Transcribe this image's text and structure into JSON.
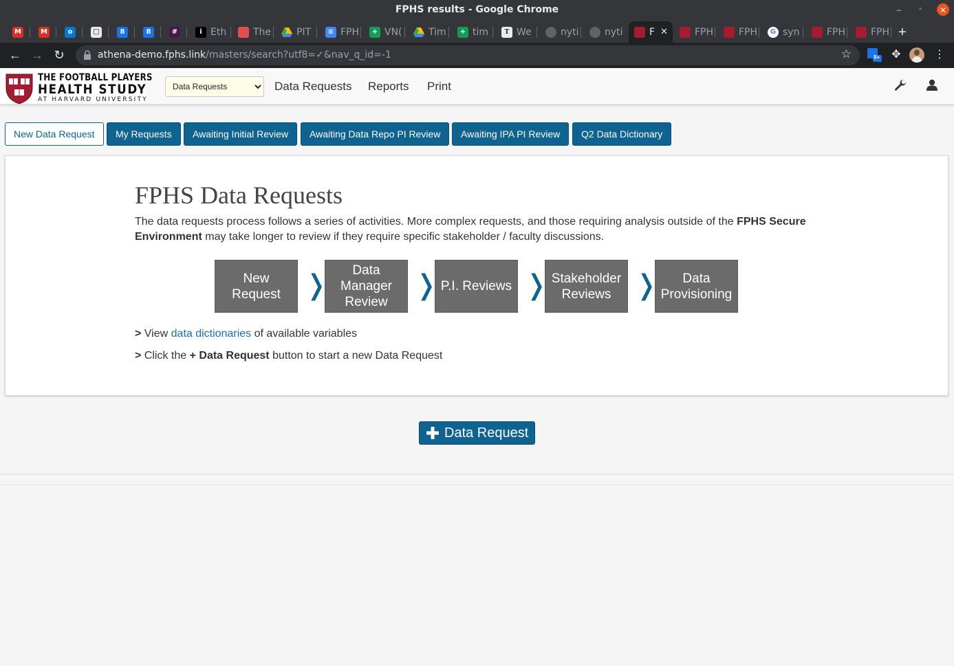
{
  "window": {
    "title": "FPHS results - Google Chrome"
  },
  "tabs": [
    {
      "label": "",
      "icon": "gmail-icon",
      "color": "#d93025"
    },
    {
      "label": "",
      "icon": "gmail-icon",
      "color": "#d93025"
    },
    {
      "label": "",
      "icon": "outlook-icon",
      "color": "#0078d4"
    },
    {
      "label": "",
      "icon": "book-icon",
      "color": "#e8eaed"
    },
    {
      "label": "",
      "icon": "calendar-icon",
      "color": "#1a73e8"
    },
    {
      "label": "",
      "icon": "calendar-icon",
      "color": "#1a73e8"
    },
    {
      "label": "",
      "icon": "slack-icon",
      "color": "#e01e5a"
    },
    {
      "label": "Eth",
      "icon": "info-icon",
      "color": "#000000"
    },
    {
      "label": "The",
      "icon": "ticket-icon",
      "color": "#e05050"
    },
    {
      "label": "PIT",
      "icon": "drive-icon",
      "color": "#34a853"
    },
    {
      "label": "FPH",
      "icon": "docs-icon",
      "color": "#4285f4"
    },
    {
      "label": "VN(",
      "icon": "sheets-icon",
      "color": "#0f9d58"
    },
    {
      "label": "Tim",
      "icon": "drive-icon",
      "color": "#34a853"
    },
    {
      "label": "tim",
      "icon": "sheets-icon",
      "color": "#0f9d58"
    },
    {
      "label": "We",
      "icon": "nytimes-icon",
      "color": "#e8eaed"
    },
    {
      "label": "nyti",
      "icon": "github-icon",
      "color": "#e8eaed"
    },
    {
      "label": "nyti",
      "icon": "github-icon",
      "color": "#e8eaed"
    },
    {
      "label": "F",
      "icon": "harvard-shield-icon",
      "color": "#a51c30"
    },
    {
      "label": "FPH",
      "icon": "harvard-shield-icon",
      "color": "#a51c30"
    },
    {
      "label": "FPH",
      "icon": "harvard-shield-icon",
      "color": "#a51c30"
    },
    {
      "label": "syn",
      "icon": "google-icon",
      "color": "#ffffff"
    },
    {
      "label": "FPH",
      "icon": "harvard-shield-icon",
      "color": "#a51c30"
    },
    {
      "label": "FPH",
      "icon": "harvard-shield-icon",
      "color": "#a51c30"
    }
  ],
  "address": {
    "host": "athena-demo.fphs.link",
    "path": "/masters/search?utf8=✓&nav_q_id=-1",
    "extension_badge": "9+"
  },
  "app": {
    "logo": {
      "line1": "THE FOOTBALL PLAYERS",
      "line2": "HEALTH STUDY",
      "line3": "AT HARVARD UNIVERSITY"
    },
    "select_value": "Data Requests",
    "nav": [
      "Data Requests",
      "Reports",
      "Print"
    ]
  },
  "buttons": [
    "New Data Request",
    "My Requests",
    "Awaiting Initial Review",
    "Awaiting Data Repo PI Review",
    "Awaiting IPA PI Review",
    "Q2 Data Dictionary"
  ],
  "panel": {
    "heading": "FPHS Data Requests",
    "intro_before": "The data requests process follows a series of activities. More complex requests, and those requiring analysis outside of the ",
    "intro_bold": "FPHS Secure Environment",
    "intro_after": " may take longer to review if they require specific stakeholder / faculty discussions.",
    "steps": [
      "New Request",
      "Data Manager Review",
      "P.I. Reviews",
      "Stakeholder Reviews",
      "Data Provisioning"
    ],
    "line1_prefix": "> ",
    "line1_before": "View ",
    "line1_link": "data dictionaries",
    "line1_after": " of available variables",
    "line2_prefix": "> ",
    "line2_before": "Click the ",
    "line2_bold": "+ Data Request",
    "line2_after": " button to start a new Data Request"
  },
  "primary_button": "Data Request",
  "colors": {
    "brand_blue": "#0e6390",
    "harvard_crimson": "#a51c30",
    "step_gray": "#6b6b6b"
  }
}
